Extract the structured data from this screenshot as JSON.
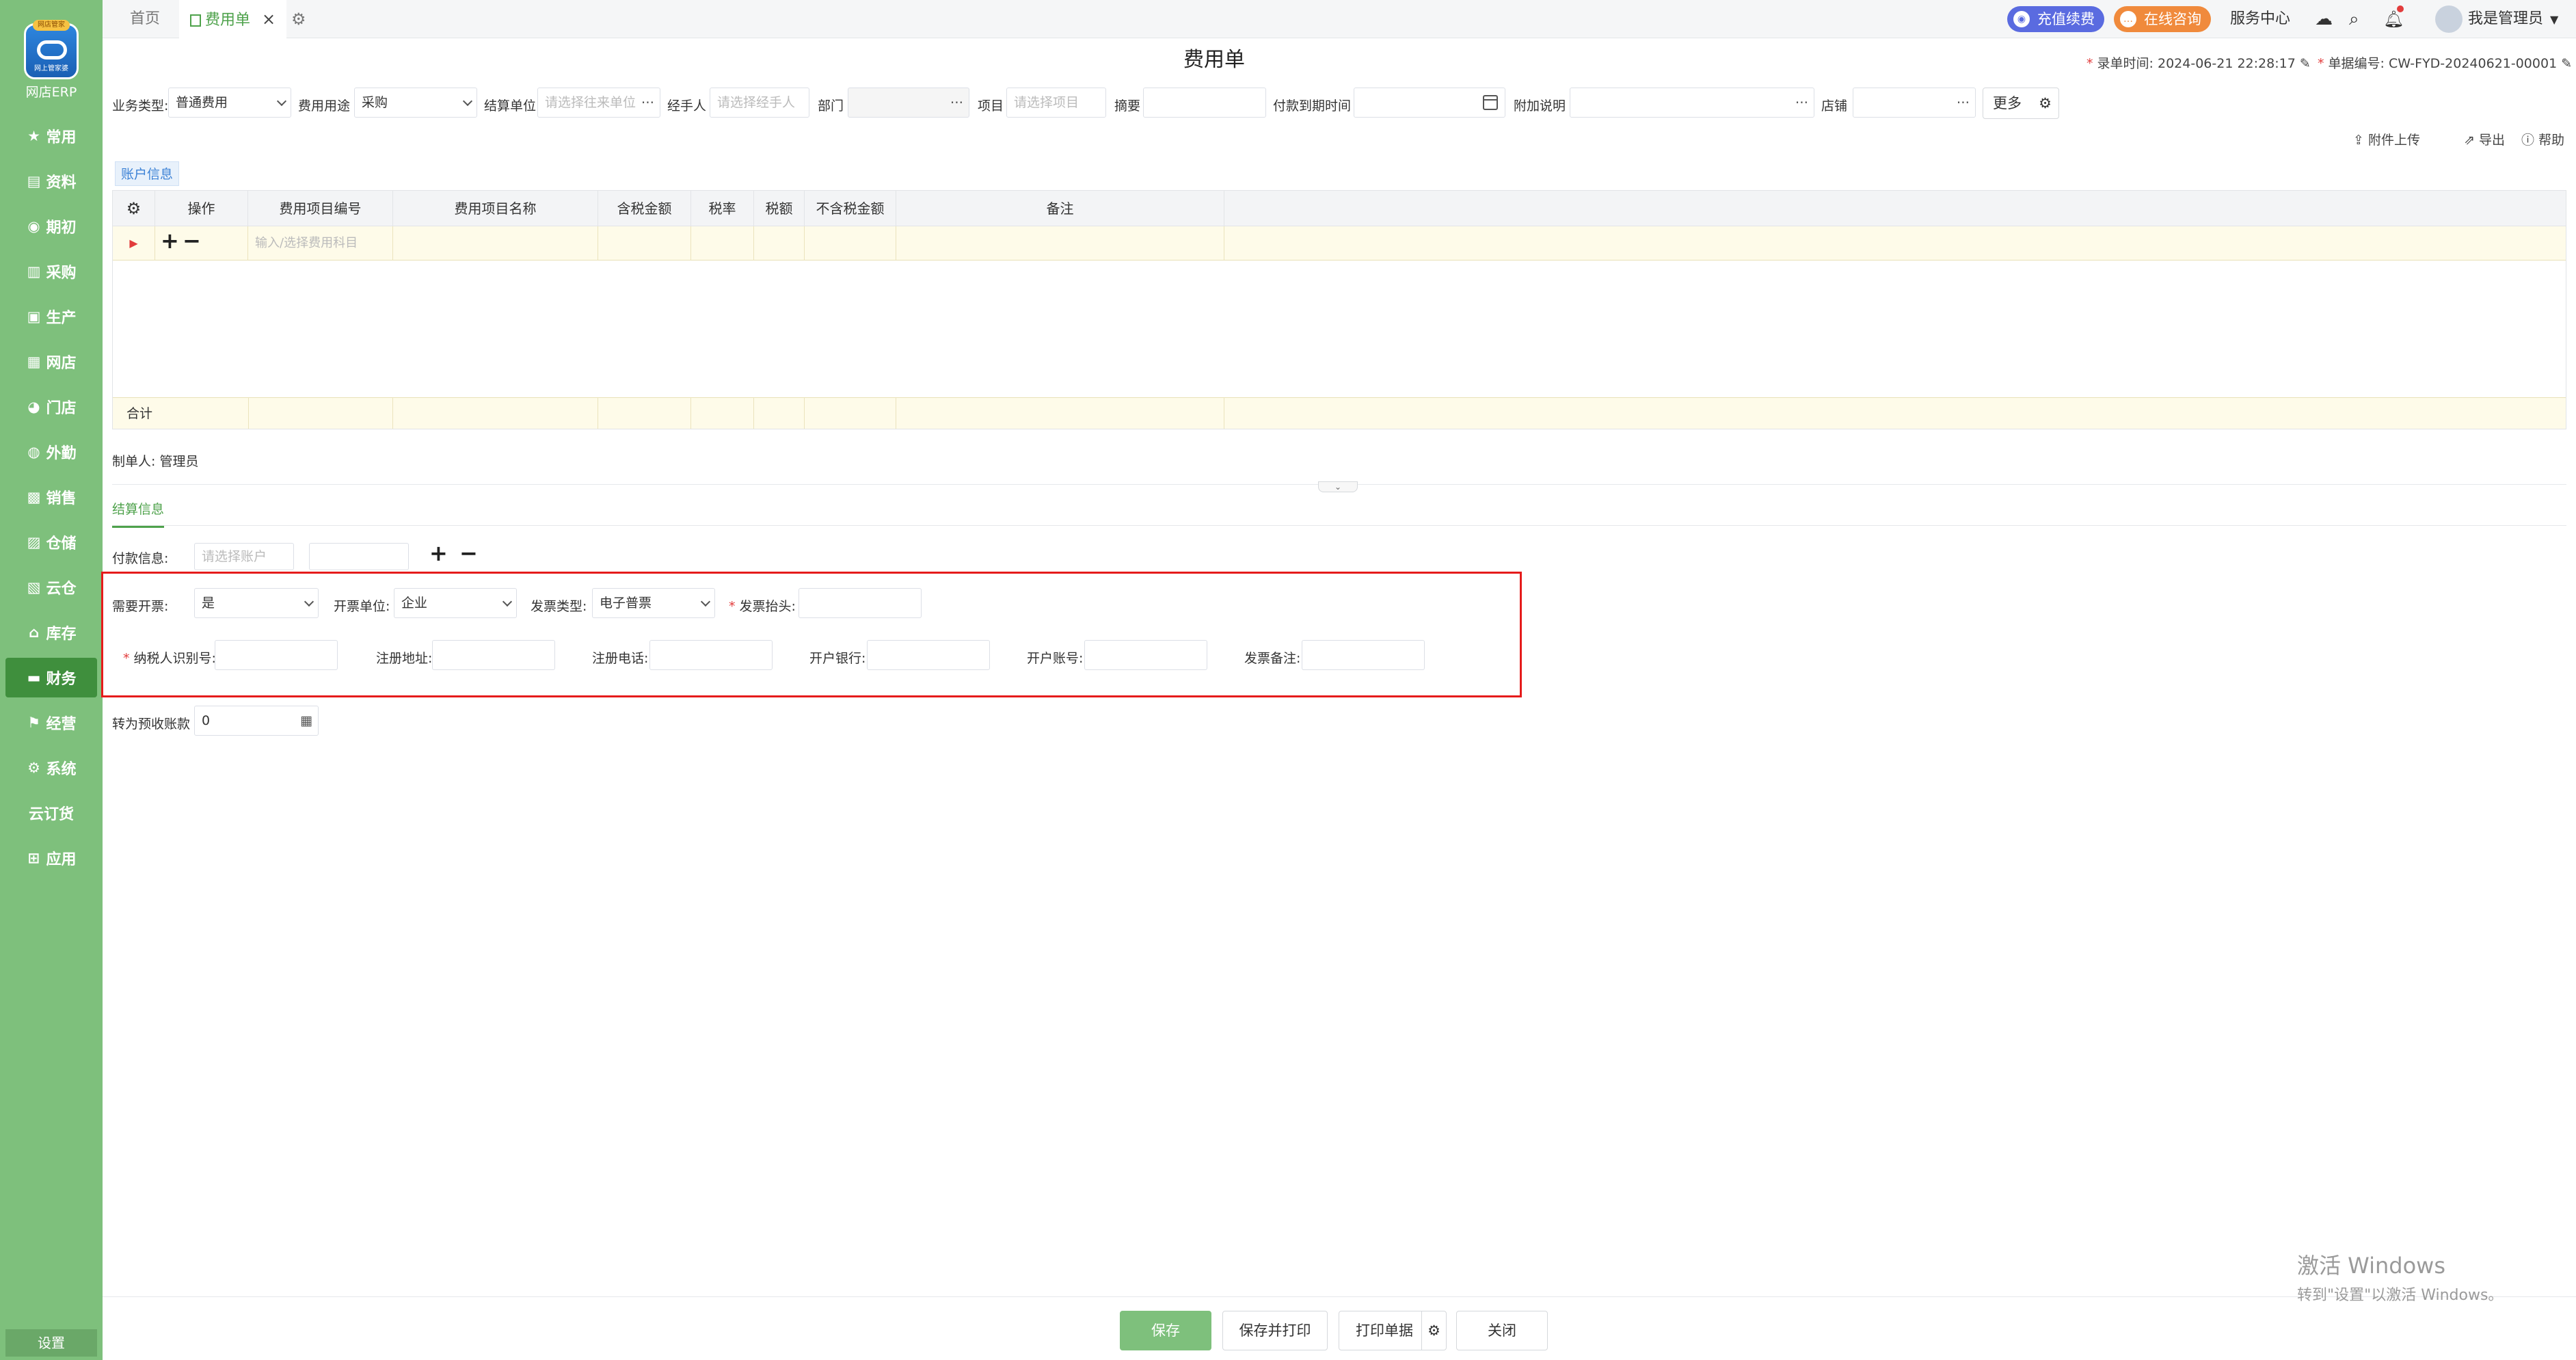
{
  "sidebar": {
    "logo_ribbon": "网店管家",
    "logo_text": "网上管家婆",
    "app_name": "网店ERP",
    "items": [
      {
        "label": "常用",
        "icon": "★",
        "name": "star-icon"
      },
      {
        "label": "资料",
        "icon": "▤",
        "name": "document-icon"
      },
      {
        "label": "期初",
        "icon": "◉",
        "name": "period-icon"
      },
      {
        "label": "采购",
        "icon": "▥",
        "name": "purchase-icon"
      },
      {
        "label": "生产",
        "icon": "▣",
        "name": "production-icon"
      },
      {
        "label": "网店",
        "icon": "▦",
        "name": "store-icon"
      },
      {
        "label": "门店",
        "icon": "◕",
        "name": "shop-icon"
      },
      {
        "label": "外勤",
        "icon": "◍",
        "name": "field-icon"
      },
      {
        "label": "销售",
        "icon": "▩",
        "name": "sales-icon"
      },
      {
        "label": "仓储",
        "icon": "▨",
        "name": "warehouse-icon"
      },
      {
        "label": "云仓",
        "icon": "▧",
        "name": "cloud-warehouse-icon"
      },
      {
        "label": "库存",
        "icon": "⌂",
        "name": "inventory-icon"
      },
      {
        "label": "财务",
        "icon": "▬",
        "name": "finance-icon"
      },
      {
        "label": "经营",
        "icon": "⚑",
        "name": "operation-icon"
      },
      {
        "label": "系统",
        "icon": "⚙",
        "name": "system-icon"
      },
      {
        "label": "云订货",
        "icon": "",
        "name": "cloud-order-icon"
      },
      {
        "label": "应用",
        "icon": "⊞",
        "name": "apps-icon"
      }
    ],
    "active_index": 12,
    "settings_label": "设置"
  },
  "topbar": {
    "tab_home": "首页",
    "tab_active": "费用单",
    "tab_close": "×",
    "recharge": "充值续费",
    "consult": "在线咨询",
    "service_center": "服务中心",
    "user": "我是管理员"
  },
  "document": {
    "title": "费用单",
    "entry_time_label": "录单时间:",
    "entry_time": "2024-06-21 22:28:17",
    "doc_no_label": "单据编号:",
    "doc_no": "CW-FYD-20240621-00001"
  },
  "form": {
    "business_type_label": "业务类型:",
    "business_type": "普通费用",
    "expense_use_label": "费用用途",
    "expense_use": "采购",
    "settle_unit_label": "结算单位",
    "settle_unit_ph": "请选择往来单位",
    "handler_label": "经手人",
    "handler_ph": "请选择经手人",
    "dept_label": "部门",
    "project_label": "项目",
    "project_ph": "请选择项目",
    "summary_label": "摘要",
    "pay_due_label": "付款到期时间",
    "extra_label": "附加说明",
    "shop_label": "店铺",
    "more_label": "更多"
  },
  "actions": {
    "attach": "附件上传",
    "export": "导出",
    "help": "帮助"
  },
  "account_tab": "账户信息",
  "grid": {
    "headers": [
      "操作",
      "费用项目编号",
      "费用项目名称",
      "含税金额",
      "税率",
      "税额",
      "不含税金额",
      "备注"
    ],
    "row_placeholder": "输入/选择费用科目",
    "footer_label": "合计"
  },
  "maker": "制单人: 管理员",
  "settlement": {
    "tab": "结算信息",
    "payment_label": "付款信息:",
    "payment_ph": "请选择账户"
  },
  "invoice": {
    "need_label": "需要开票:",
    "need_value": "是",
    "unit_label": "开票单位:",
    "unit_value": "企业",
    "type_label": "发票类型:",
    "type_value": "电子普票",
    "header_label": "发票抬头:",
    "taxid_label": "纳税人识别号:",
    "address_label": "注册地址:",
    "phone_label": "注册电话:",
    "bank_label": "开户银行:",
    "account_label": "开户账号:",
    "remark_label": "发票备注:"
  },
  "advance": {
    "label": "转为预收账款",
    "value": "0"
  },
  "footer": {
    "save": "保存",
    "save_print": "保存并打印",
    "print": "打印单据",
    "close": "关闭"
  },
  "watermark": {
    "line1": "激活 Windows",
    "line2": "转到\"设置\"以激活 Windows。"
  },
  "colors": {
    "sidebar": "#7ec07c",
    "sidebar_active": "#3f8f3d",
    "primary": "#4ea24b",
    "recharge": "#5a6be0",
    "consult": "#f08a3c",
    "highlight_box": "#e51b1b"
  }
}
